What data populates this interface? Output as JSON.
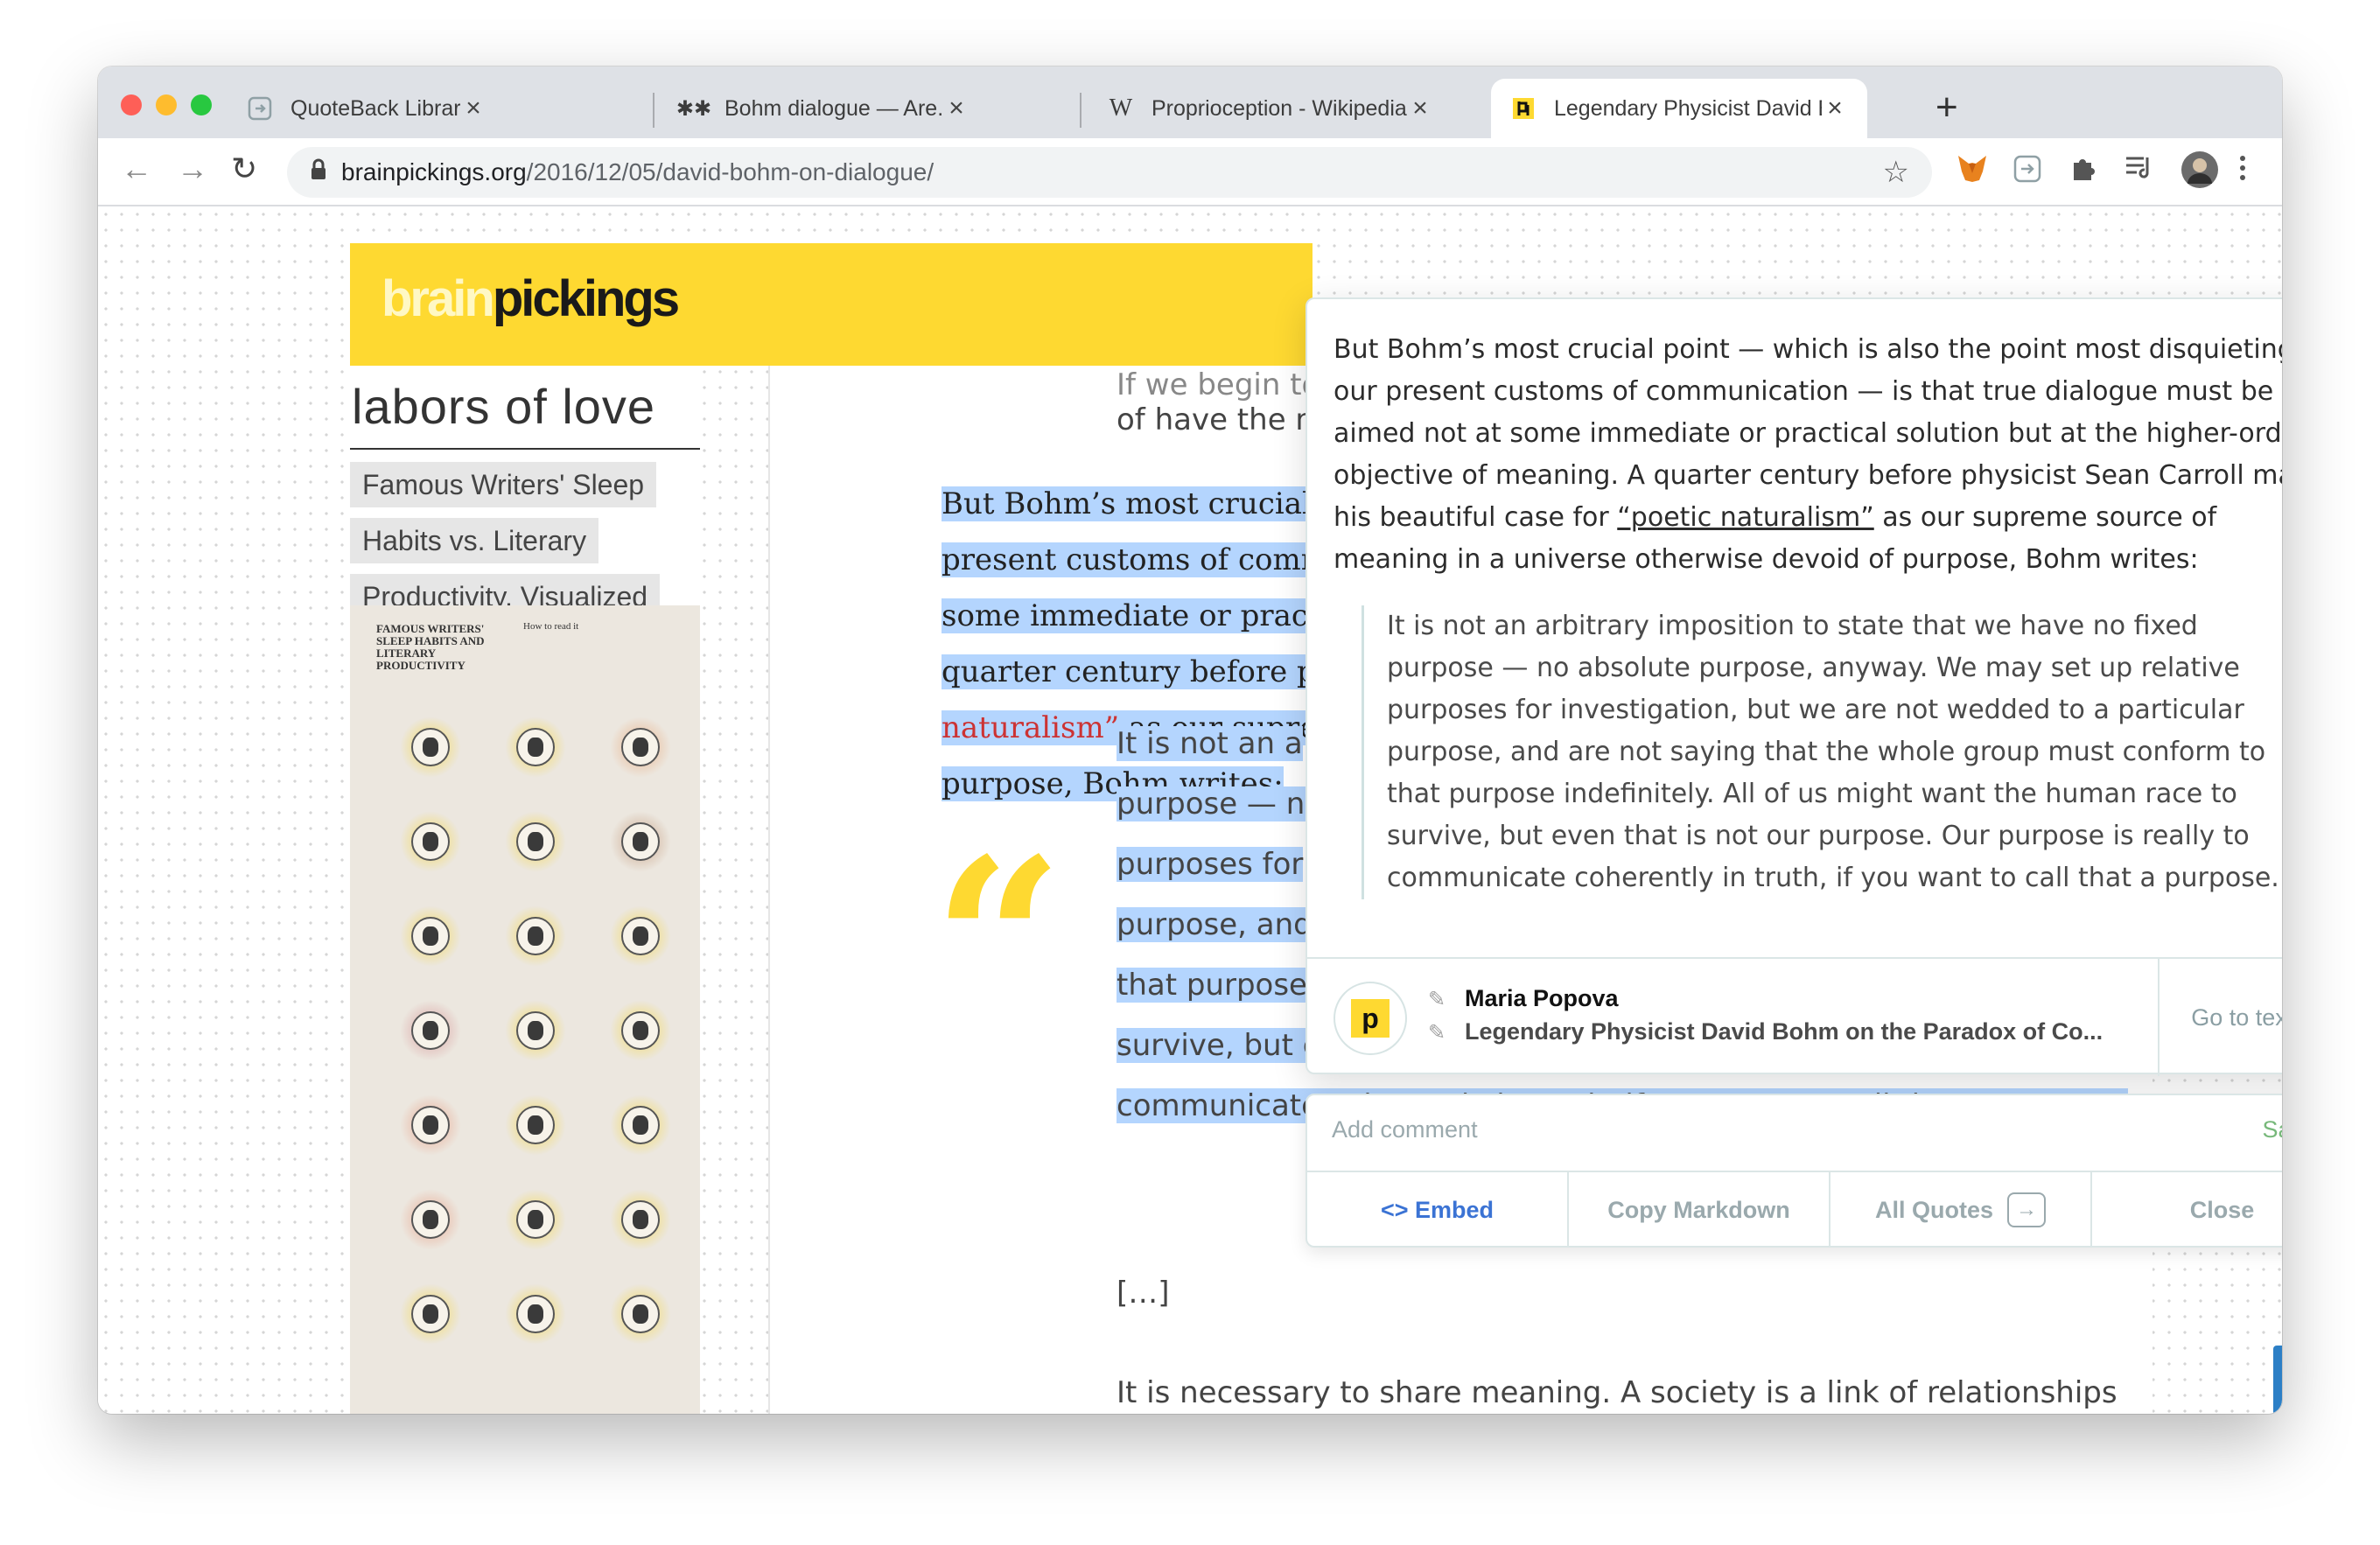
{
  "tabs": [
    {
      "title": "QuoteBack Library",
      "icon": "quoteback-icon"
    },
    {
      "title": "Bohm dialogue — Are.na",
      "icon": "arena-icon"
    },
    {
      "title": "Proprioception - Wikipedia",
      "icon": "wikipedia-icon"
    },
    {
      "title": "Legendary Physicist David Bohm",
      "icon": "brainpickings-icon",
      "active": true
    }
  ],
  "address": {
    "domain": "brainpickings.org",
    "path": "/2016/12/05/david-bohm-on-dialogue/"
  },
  "site": {
    "logo_light": "brain",
    "logo_dark": "pickings"
  },
  "sidebar": {
    "heading": "labors of love",
    "items": [
      "Famous Writers' Sleep",
      "Habits vs. Literary",
      "Productivity, Visualized"
    ],
    "infographic_title": "FAMOUS WRITERS' SLEEP HABITS AND LITERARY PRODUCTIVITY",
    "infographic_sub": "How to read it"
  },
  "article": {
    "lead_1": "If we begin to",
    "lead_2": "of have the m",
    "hl_lines": [
      "But Bohm’s most crucial po",
      "present customs of commu",
      "some immediate or practic",
      "quarter century before phy"
    ],
    "hl_red": "naturalism”",
    "hl_tail": " as our suprem",
    "hl_last": "purpose, Bohm writes:",
    "quote_lines": [
      "It is not an a",
      "purpose — no",
      "purposes for",
      "purpose, and",
      "that purpose",
      "survive, but e",
      "communicate coherently in truth, if you want to call that a purpose."
    ],
    "ellipsis": "[…]",
    "next": "It is necessary to share meaning. A society is a link of relationships"
  },
  "popup": {
    "para_pre": "But Bohm’s most crucial point — which is also the point most disquieting to our present customs of communication — is that true dialogue must be aimed not at some immediate or practical solution but at the higher-order objective of meaning. A quarter century before physicist Sean Carroll made his beautiful case for ",
    "para_link": "“poetic naturalism”",
    "para_post": " as our supreme source of meaning in a universe otherwise devoid of purpose, Bohm writes:",
    "quote": "It is not an arbitrary imposition to state that we have no fixed purpose — no absolute purpose, anyway. We may set up relative purposes for investigation, but we are not wedded to a particular purpose, and are not saying that the whole group must conform to that purpose indefinitely. All of us might want the human race to survive, but even that is not our purpose. Our purpose is really to communicate coherently in truth, if you want to call that a purpose.",
    "author": "Maria Popova",
    "source_title": "Legendary Physicist David Bohm on the Paradox of Co...",
    "goto": "Go to text →"
  },
  "comment": {
    "placeholder": "Add comment",
    "status": "Saved",
    "embed": "<> Embed",
    "copy": "Copy Markdown",
    "all": "All Quotes",
    "close": "Close"
  },
  "colors": {
    "accent": "#fed931",
    "highlight": "#b4d5fe",
    "embed": "#3b73d4",
    "saved": "#77b87a"
  }
}
